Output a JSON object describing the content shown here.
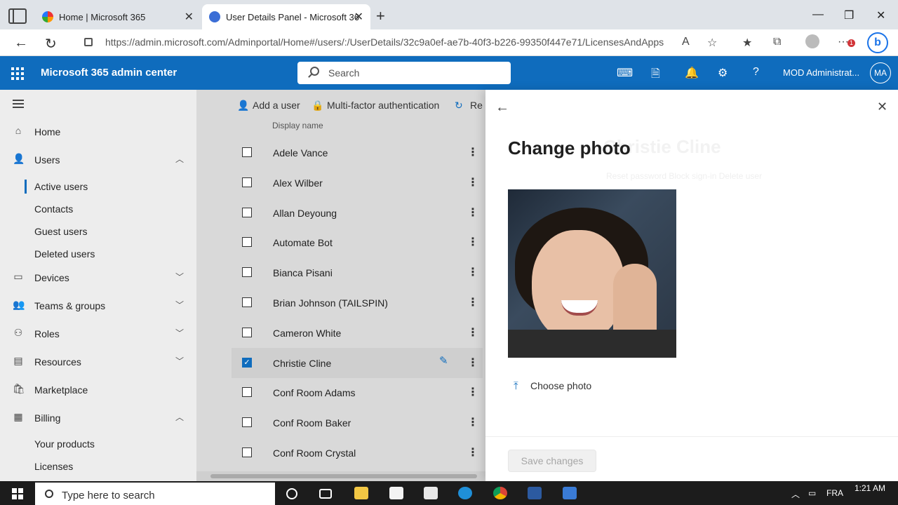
{
  "browser": {
    "tabs": [
      {
        "label": "Home | Microsoft 365"
      },
      {
        "label": "User Details Panel - Microsoft 36"
      }
    ],
    "url": "https://admin.microsoft.com/Adminportal/Home#/users/:/UserDetails/32c9a0ef-ae7b-40f3-b226-99350f447e71/LicensesAndApps",
    "notification_badge": "1"
  },
  "header": {
    "app_title": "Microsoft 365 admin center",
    "search_placeholder": "Search",
    "account_name": "MOD Administrat...",
    "avatar_initials": "MA",
    "brand_color": "#0f6cbd"
  },
  "sidebar": {
    "items": [
      {
        "label": "Home",
        "icon": "home-icon"
      },
      {
        "label": "Users",
        "icon": "person-icon",
        "expanded": true
      },
      {
        "label": "Devices",
        "icon": "laptop-icon"
      },
      {
        "label": "Teams & groups",
        "icon": "people-icon"
      },
      {
        "label": "Roles",
        "icon": "roles-icon"
      },
      {
        "label": "Resources",
        "icon": "resources-icon"
      },
      {
        "label": "Marketplace",
        "icon": "store-icon"
      },
      {
        "label": "Billing",
        "icon": "billing-icon",
        "expanded": true
      }
    ],
    "users_sub": [
      "Active users",
      "Contacts",
      "Guest users",
      "Deleted users"
    ],
    "billing_sub": [
      "Your products",
      "Licenses"
    ]
  },
  "users": {
    "commands": [
      "Add a user",
      "Multi-factor authentication",
      "Re"
    ],
    "column_header": "Display name",
    "rows": [
      {
        "name": "Adele Vance",
        "selected": false
      },
      {
        "name": "Alex Wilber",
        "selected": false
      },
      {
        "name": "Allan Deyoung",
        "selected": false
      },
      {
        "name": "Automate Bot",
        "selected": false
      },
      {
        "name": "Bianca Pisani",
        "selected": false
      },
      {
        "name": "Brian Johnson (TAILSPIN)",
        "selected": false
      },
      {
        "name": "Cameron White",
        "selected": false
      },
      {
        "name": "Christie Cline",
        "selected": true
      },
      {
        "name": "Conf Room Adams",
        "selected": false
      },
      {
        "name": "Conf Room Baker",
        "selected": false
      },
      {
        "name": "Conf Room Crystal",
        "selected": false
      }
    ]
  },
  "panel": {
    "title": "Change photo",
    "background_title": "Christie Cline",
    "background_links": "Reset password     Block sign-in     Delete user",
    "choose_photo": "Choose photo",
    "save_button": "Save changes"
  },
  "taskbar": {
    "search_placeholder": "Type here to search",
    "language": "FRA",
    "time": "1:21 AM"
  }
}
